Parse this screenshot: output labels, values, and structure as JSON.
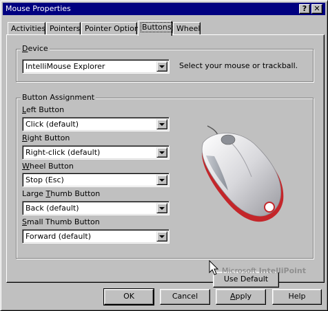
{
  "window": {
    "title": "Mouse Properties",
    "help_btn": "?",
    "close_btn": "✕"
  },
  "tabs": [
    {
      "label": "Activities",
      "active": false
    },
    {
      "label": "Pointers",
      "active": false
    },
    {
      "label": "Pointer Options",
      "active": false
    },
    {
      "label": "Buttons",
      "active": true
    },
    {
      "label": "Wheel",
      "active": false
    }
  ],
  "device": {
    "group_label": "Device",
    "value": "IntelliMouse Explorer",
    "hint": "Select your mouse or trackball."
  },
  "assignment": {
    "group_label": "Button Assignment",
    "left": {
      "label": "Left Button",
      "value": "Click (default)"
    },
    "right": {
      "label": "Right Button",
      "value": "Right-click (default)"
    },
    "wheel": {
      "label": "Wheel Button",
      "value": "Stop (Esc)"
    },
    "large": {
      "label": "Large Thumb Button",
      "value": "Back (default)"
    },
    "small": {
      "label": "Small Thumb Button",
      "value": "Forward (default)"
    },
    "use_default": "Use Default"
  },
  "brand": {
    "company": "Microsoft",
    "product": "IntelliPoint"
  },
  "footer": {
    "ok": "OK",
    "cancel": "Cancel",
    "apply": "Apply",
    "help": "Help"
  },
  "colors": {
    "titlebar": "#000080",
    "face": "#c0c0c0",
    "mouse_accent": "#cc2222"
  }
}
